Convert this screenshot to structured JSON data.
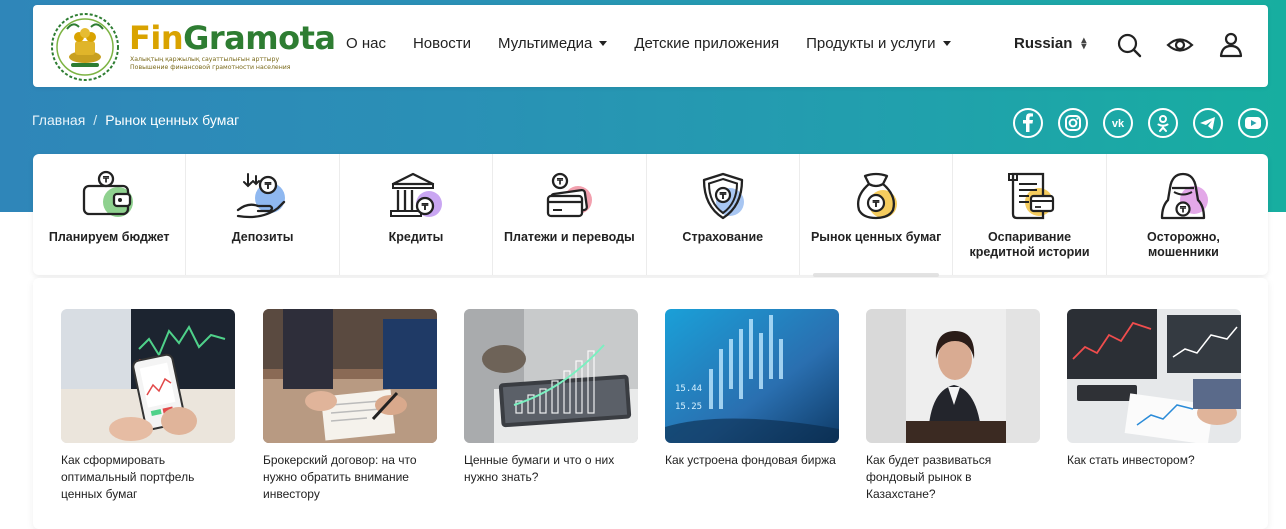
{
  "brand": {
    "name_part1": "Fin",
    "name_part2": "Gramota",
    "tagline_kz": "Халықтың қаржылық сауаттылығын арттыру",
    "tagline_ru": "Повышение финансовой грамотности населения"
  },
  "nav": {
    "items": [
      {
        "label": "О нас",
        "dropdown": false
      },
      {
        "label": "Новости",
        "dropdown": false
      },
      {
        "label": "Мультимедиа",
        "dropdown": true
      },
      {
        "label": "Детские приложения",
        "dropdown": false
      },
      {
        "label": "Продукты и услуги",
        "dropdown": true
      }
    ],
    "language": "Russian"
  },
  "header_icons": [
    "search-icon",
    "eye-icon",
    "user-icon"
  ],
  "breadcrumb": {
    "home": "Главная",
    "separator": "/",
    "current": "Рынок ценных бумаг"
  },
  "social_icons": [
    "facebook-icon",
    "instagram-icon",
    "vk-icon",
    "odnoklassniki-icon",
    "telegram-icon",
    "youtube-icon"
  ],
  "categories": [
    {
      "label": "Планируем бюджет",
      "icon": "wallet-icon",
      "accent": "#8fd18f"
    },
    {
      "label": "Депозиты",
      "icon": "deposit-hand-icon",
      "accent": "#8fb8f0"
    },
    {
      "label": "Кредиты",
      "icon": "bank-icon",
      "accent": "#c9a6f2"
    },
    {
      "label": "Платежи и переводы",
      "icon": "cards-icon",
      "accent": "#f2a0ae"
    },
    {
      "label": "Страхование",
      "icon": "shield-icon",
      "accent": "#a8c6f2"
    },
    {
      "label": "Рынок ценных бумаг",
      "icon": "money-bag-icon",
      "accent": "#f5cc5e"
    },
    {
      "label": "Оспаривание кредитной истории",
      "icon": "document-card-icon",
      "accent": "#f5cc5e"
    },
    {
      "label": "Осторожно, мошенники",
      "icon": "fraudster-icon",
      "accent": "#e3a8e8"
    }
  ],
  "active_category": "Рынок ценных бумаг",
  "articles": [
    {
      "title": "Как сформировать оптимальный портфель ценных бумаг",
      "image": "trading-phone-image"
    },
    {
      "title": "Брокерский договор: на что нужно обратить внимание инвестору",
      "image": "signing-contract-image"
    },
    {
      "title": "Ценные бумаги и что о них нужно знать?",
      "image": "tablet-growth-chart-image"
    },
    {
      "title": "Как устроена фондовая биржа",
      "image": "stock-exchange-board-image"
    },
    {
      "title": "Как будет развиваться фондовый рынок в Казахстане?",
      "image": "businesswoman-image"
    },
    {
      "title": "Как стать инвестором?",
      "image": "investor-charts-image"
    }
  ],
  "colors": {
    "hero_start": "#2f86b9",
    "hero_end": "#17aea0",
    "brand_gold": "#d9a300",
    "brand_green": "#2e7d32"
  }
}
